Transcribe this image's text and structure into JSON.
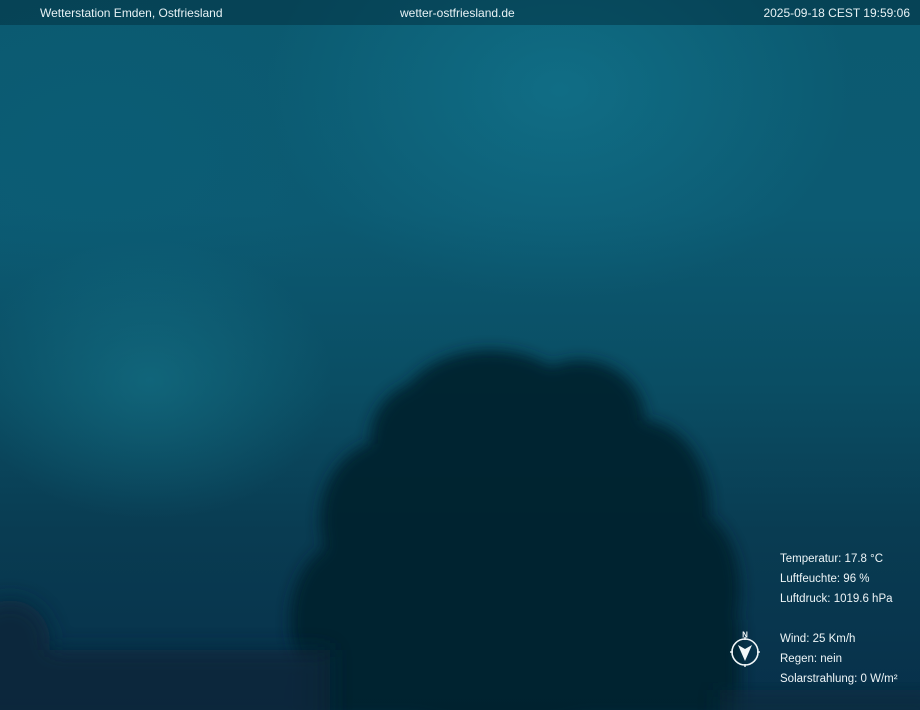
{
  "header": {
    "station": "Wetterstation Emden, Ostfriesland",
    "website": "wetter-ostfriesland.de",
    "timestamp": "2025-09-18 CEST 19:59:06"
  },
  "readings": {
    "temperature": "Temperatur: 17.8 °C",
    "humidity": "Luftfeuchte: 96 %",
    "pressure": "Luftdruck: 1019.6 hPa",
    "wind": "Wind: 25 Km/h",
    "rain": "Regen: nein",
    "solar": "Solarstrahlung: 0 W/m²"
  },
  "compass": {
    "north_label": "N",
    "icon": "compass-icon"
  }
}
